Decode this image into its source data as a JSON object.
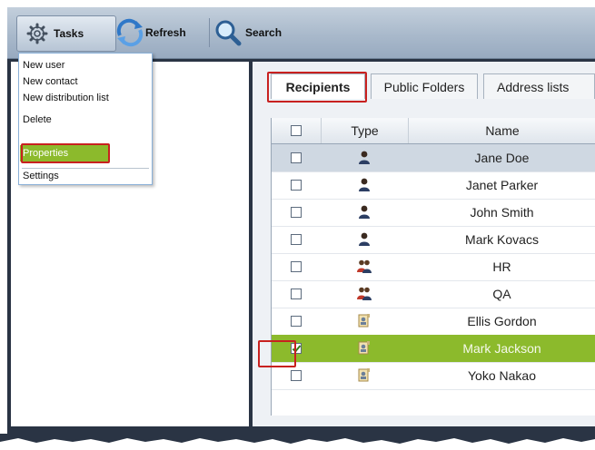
{
  "toolbar": {
    "tasks_label": "Tasks",
    "refresh_label": "Refresh",
    "search_label": "Search"
  },
  "tasks_menu": {
    "items": [
      {
        "label": "New user"
      },
      {
        "label": "New contact"
      },
      {
        "label": "New distribution list"
      },
      {
        "label": "Delete"
      },
      {
        "label": "Properties",
        "active": true
      },
      {
        "label": "Settings"
      }
    ]
  },
  "tabs": [
    {
      "label": "Recipients",
      "active": true
    },
    {
      "label": "Public Folders"
    },
    {
      "label": "Address lists"
    }
  ],
  "grid": {
    "columns": [
      "Type",
      "Name"
    ],
    "rows": [
      {
        "name": "Jane Doe",
        "type_icon": "user-icon",
        "checked": false
      },
      {
        "name": "Janet Parker",
        "type_icon": "user-icon",
        "checked": false
      },
      {
        "name": "John Smith",
        "type_icon": "user-icon",
        "checked": false
      },
      {
        "name": "Mark Kovacs",
        "type_icon": "user-icon",
        "checked": false
      },
      {
        "name": "HR",
        "type_icon": "group-icon",
        "checked": false
      },
      {
        "name": "QA",
        "type_icon": "group-icon",
        "checked": false
      },
      {
        "name": "Ellis Gordon",
        "type_icon": "contact-icon",
        "checked": false
      },
      {
        "name": "Mark Jackson",
        "type_icon": "contact-icon",
        "checked": true
      },
      {
        "name": "Yoko Nakao",
        "type_icon": "contact-icon",
        "checked": false
      }
    ]
  },
  "colors": {
    "selection_green": "#8cba2c",
    "highlight_red": "#c8211f",
    "frame_dark": "#2a3444"
  }
}
